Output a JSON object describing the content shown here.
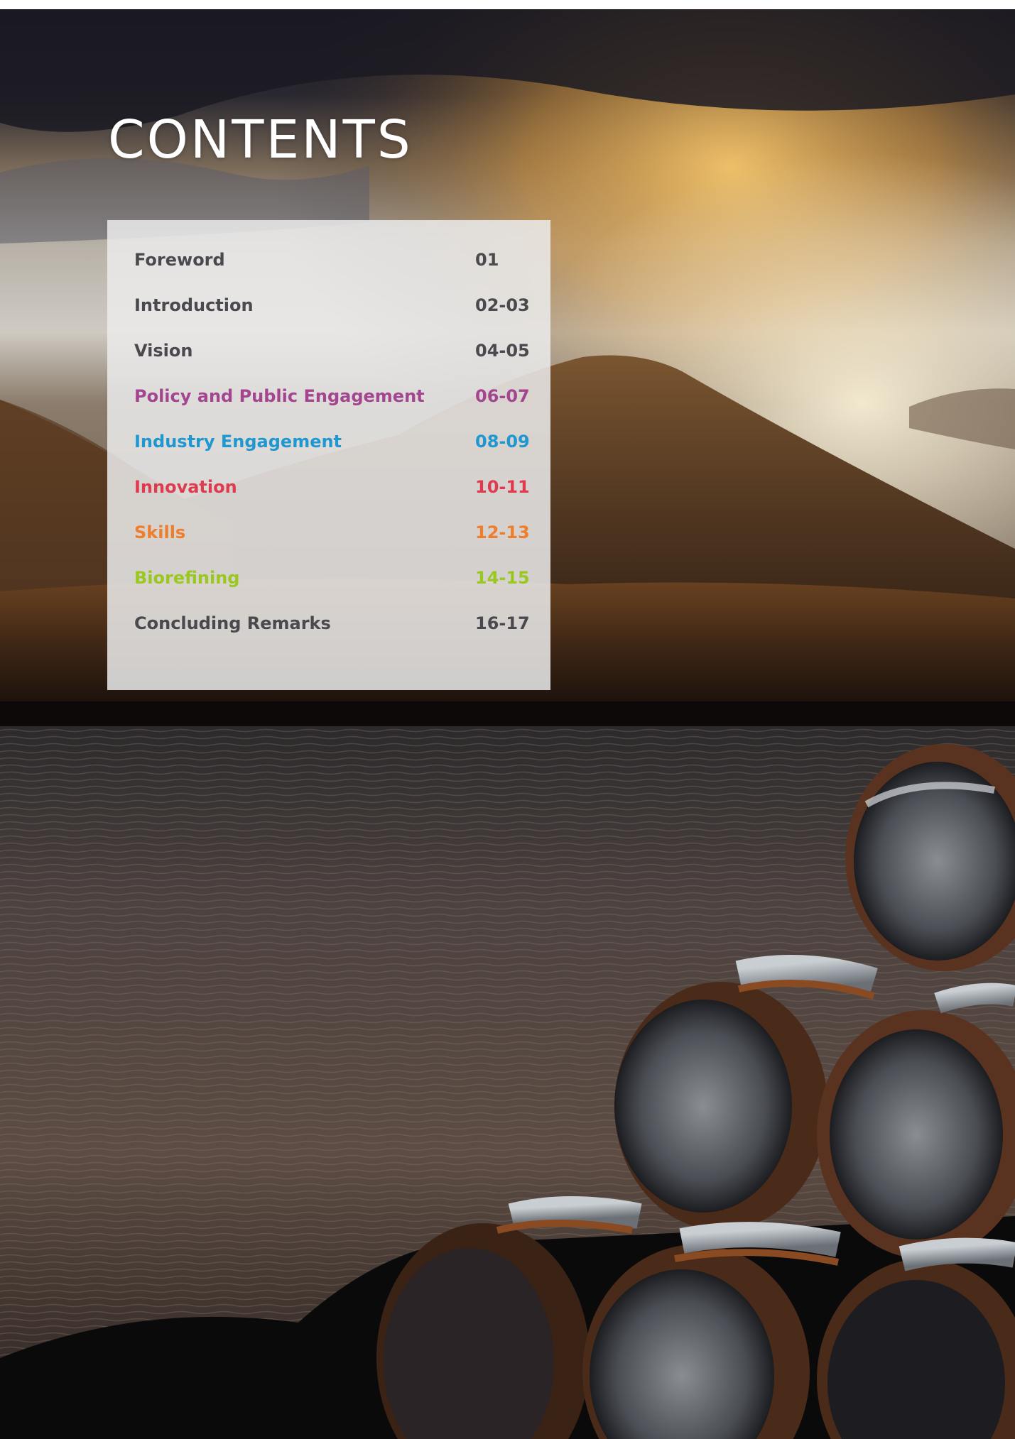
{
  "page": {
    "title": "CONTENTS"
  },
  "toc": {
    "items": [
      {
        "label": "Foreword",
        "pages": "01",
        "color": "#4a4a4e"
      },
      {
        "label": "Introduction",
        "pages": "02-03",
        "color": "#4a4a4e"
      },
      {
        "label": "Vision",
        "pages": "04-05",
        "color": "#4a4a4e"
      },
      {
        "label": "Policy and Public Engagement",
        "pages": "06-07",
        "color": "#a3458f"
      },
      {
        "label": "Industry Engagement",
        "pages": "08-09",
        "color": "#1f97d0"
      },
      {
        "label": "Innovation",
        "pages": "10-11",
        "color": "#e03a4e"
      },
      {
        "label": "Skills",
        "pages": "12-13",
        "color": "#ee7d2c"
      },
      {
        "label": "Biorefining",
        "pages": "14-15",
        "color": "#9ac81e"
      },
      {
        "label": "Concluding Remarks",
        "pages": "16-17",
        "color": "#4a4a4e"
      }
    ]
  },
  "colors": {
    "sky_dark": "#1d1c27",
    "sky_gold": "#d9a24a",
    "mountain": "#5a3a1e",
    "sea": "#3b3330",
    "panel": "#ebebeb"
  }
}
